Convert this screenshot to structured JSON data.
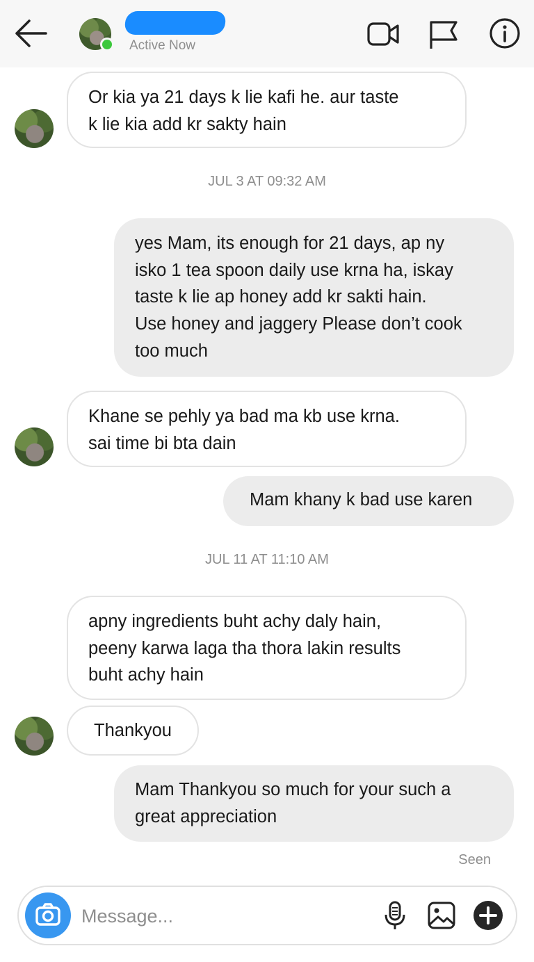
{
  "header": {
    "status": "Active Now",
    "icons": [
      "back-arrow-icon",
      "video-call-icon",
      "flag-icon",
      "info-icon"
    ]
  },
  "messages": [
    {
      "dir": "in",
      "text": "Or kia ya 21 days k lie kafi he. aur taste\nk lie kia add kr sakty hain"
    },
    {
      "dir": "out",
      "text": "yes Mam, its enough for 21 days, ap ny\nisko 1 tea spoon daily use krna ha, iskay\ntaste k lie ap honey add kr sakti hain.\nUse honey and jaggery Please don’t cook\ntoo much"
    },
    {
      "dir": "in",
      "text": "Khane se pehly ya bad ma kb use krna.\nsai time bi bta dain"
    },
    {
      "dir": "out",
      "text": "Mam khany k bad use karen"
    },
    {
      "dir": "in",
      "text": "apny ingredients buht achy daly hain,\npeeny karwa laga tha thora lakin results\nbuht achy hain"
    },
    {
      "dir": "in",
      "text": "Thankyou"
    },
    {
      "dir": "out",
      "text": "Mam Thankyou so much for your such a\ngreat appreciation"
    }
  ],
  "timestamps": [
    "JUL 3 AT 09:32 AM",
    "JUL 11 AT 11:10 AM"
  ],
  "seen": "Seen",
  "composer": {
    "placeholder": "Message...",
    "icons": [
      "camera-icon",
      "microphone-icon",
      "gallery-icon",
      "plus-icon"
    ]
  },
  "colors": {
    "accent": "#3897f0",
    "online": "#3cc83c",
    "outgoing_bubble": "#ececec",
    "name_redaction": "#1a8cff"
  }
}
